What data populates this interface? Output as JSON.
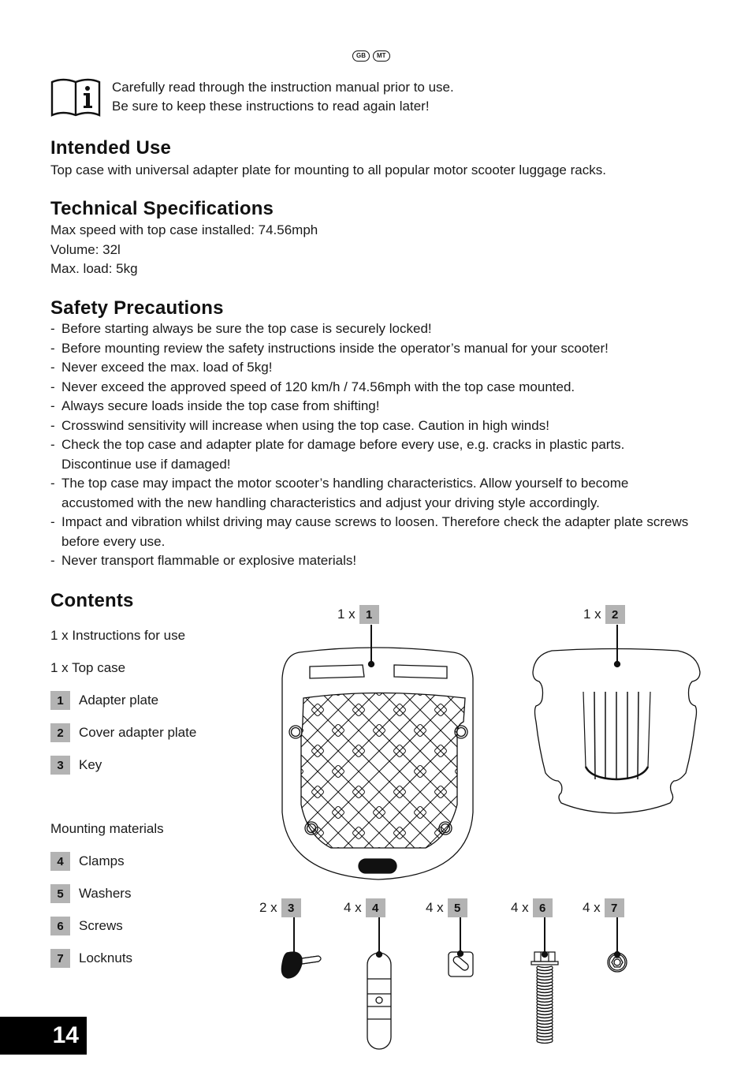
{
  "language_badges": [
    "GB",
    "MT"
  ],
  "notice": {
    "icon": "book-info-icon",
    "lines": [
      "Carefully read through the instruction manual prior to use.",
      "Be sure to keep these instructions to read again later!"
    ]
  },
  "intended_use": {
    "heading": "Intended Use",
    "text": "Top case with universal adapter plate for mounting to all popular motor scooter luggage racks."
  },
  "technical_specifications": {
    "heading": "Technical Specifications",
    "lines": [
      "Max speed with top case installed: 74.56mph",
      "Volume: 32l",
      "Max. load: 5kg"
    ]
  },
  "safety_precautions": {
    "heading": "Safety Precautions",
    "items": [
      "Before starting always be sure the top case is securely locked!",
      "Before mounting review the safety instructions inside the operator’s manual for your scooter!",
      "Never exceed the max. load of 5kg!",
      "Never exceed the approved speed of 120 km/h / 74.56mph with the top case mounted.",
      "Always secure loads inside the top case from shifting!",
      "Crosswind sensitivity will increase when using the top case. Caution in high winds!",
      "Check the top case and adapter plate for damage before every use, e.g. cracks in plastic parts. Discontinue use if damaged!",
      "The top case may impact the motor scooter’s handling characteristics. Allow yourself to become accustomed with the new handling characteristics and adjust your driving style accordingly.",
      "Impact and vibration whilst driving may cause screws to loosen. Therefore check the adapter plate screws before every use.",
      "Never transport flammable or explosive materials!"
    ]
  },
  "contents": {
    "heading": "Contents",
    "plain_items": [
      "1 x Instructions for use",
      "1 x Top case"
    ],
    "numbered_items": [
      {
        "num": "1",
        "label": "Adapter plate"
      },
      {
        "num": "2",
        "label": "Cover adapter plate"
      },
      {
        "num": "3",
        "label": "Key"
      }
    ],
    "mounting_heading": "Mounting materials",
    "mounting_items": [
      {
        "num": "4",
        "label": "Clamps"
      },
      {
        "num": "5",
        "label": "Washers"
      },
      {
        "num": "6",
        "label": "Screws"
      },
      {
        "num": "7",
        "label": "Locknuts"
      }
    ]
  },
  "callouts": [
    {
      "qty": "1 x",
      "num": "1",
      "part": "adapter-plate"
    },
    {
      "qty": "1 x",
      "num": "2",
      "part": "cover-adapter-plate"
    },
    {
      "qty": "2 x",
      "num": "3",
      "part": "key"
    },
    {
      "qty": "4 x",
      "num": "4",
      "part": "clamp"
    },
    {
      "qty": "4 x",
      "num": "5",
      "part": "washer"
    },
    {
      "qty": "4 x",
      "num": "6",
      "part": "screw"
    },
    {
      "qty": "4 x",
      "num": "7",
      "part": "locknut"
    }
  ],
  "colors": {
    "badge_gray": "#b3b3b3",
    "text": "#1a1a1a",
    "page_number_bg": "#000000"
  },
  "page_number": "14"
}
